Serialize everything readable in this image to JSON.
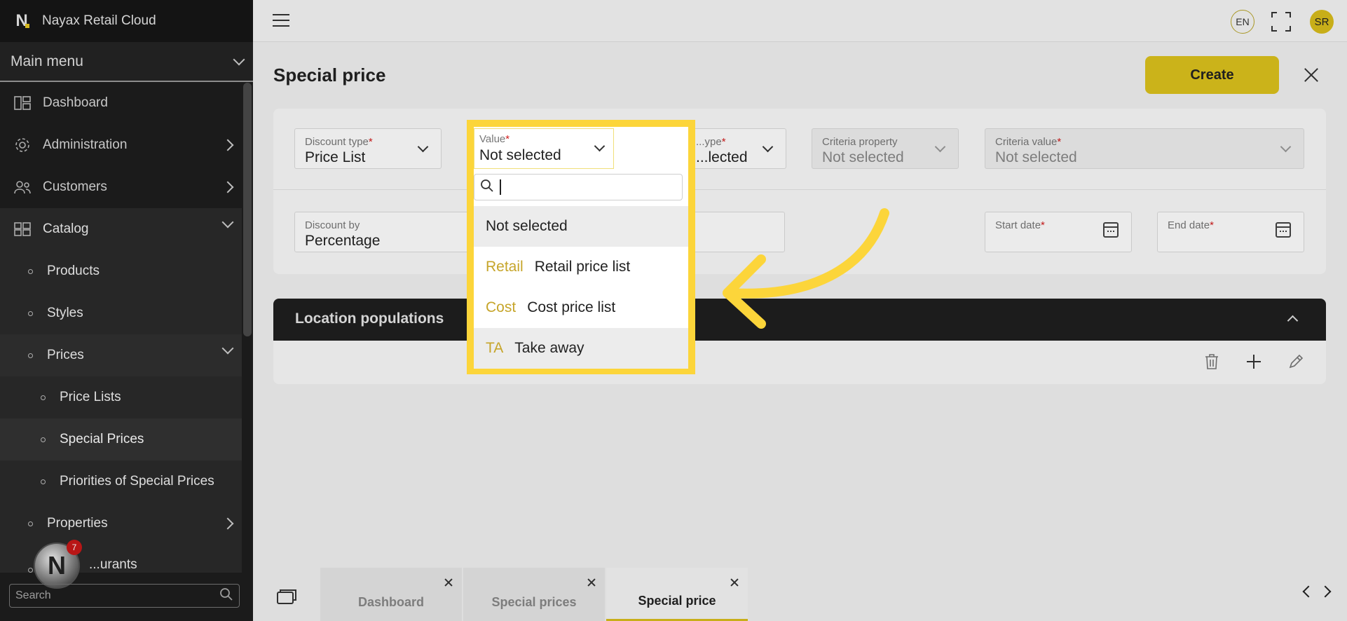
{
  "app": {
    "name": "Nayax Retail Cloud"
  },
  "sidebar": {
    "menu_title": "Main menu",
    "items": [
      {
        "label": "Dashboard"
      },
      {
        "label": "Administration"
      },
      {
        "label": "Customers"
      },
      {
        "label": "Catalog"
      },
      {
        "label": "Products"
      },
      {
        "label": "Styles"
      },
      {
        "label": "Prices"
      },
      {
        "label": "Price Lists"
      },
      {
        "label": "Special Prices"
      },
      {
        "label": "Priorities of Special Prices"
      },
      {
        "label": "Properties"
      },
      {
        "label": "...urants"
      }
    ],
    "search_placeholder": "Search",
    "notification_count": "7"
  },
  "topbar": {
    "lang": "EN",
    "user_initials": "SR"
  },
  "page": {
    "title": "Special price",
    "create_label": "Create"
  },
  "form": {
    "discount_type": {
      "label": "Discount type",
      "value": "Price List"
    },
    "value": {
      "label": "Value",
      "value": "Not selected"
    },
    "criteria_type": {
      "label": "...ype",
      "value": "...lected"
    },
    "criteria_property": {
      "label": "Criteria property",
      "value": "Not selected"
    },
    "criteria_value": {
      "label": "Criteria value",
      "value": "Not selected"
    },
    "discount_by": {
      "label": "Discount by",
      "value": "Percentage"
    },
    "start_date": {
      "label": "Start date"
    },
    "end_date": {
      "label": "End date"
    },
    "required_mark": "*"
  },
  "dropdown": {
    "options": [
      {
        "code": "",
        "label": "Not selected"
      },
      {
        "code": "Retail",
        "label": "Retail price list"
      },
      {
        "code": "Cost",
        "label": "Cost price list"
      },
      {
        "code": "TA",
        "label": "Take away"
      }
    ]
  },
  "location_section": {
    "title": "Location populations"
  },
  "bottom_tabs": [
    {
      "label": "Dashboard"
    },
    {
      "label": "Special prices"
    },
    {
      "label": "Special price"
    }
  ],
  "colors": {
    "accent": "#DDC31D",
    "highlight": "#FCD53A",
    "sidebar": "#1E1E1E"
  }
}
